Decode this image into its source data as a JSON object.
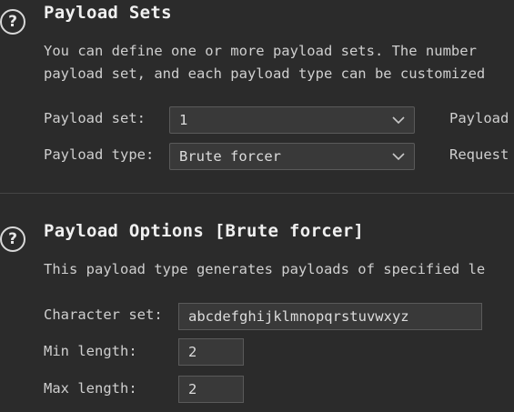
{
  "payload_sets": {
    "help_icon": "?",
    "title": "Payload Sets",
    "description_line1": "You can define one or more payload sets. The number",
    "description_line2": "payload set, and each payload type can be customized",
    "payload_set_label": "Payload set:",
    "payload_set_value": "1",
    "payload_type_label": "Payload type:",
    "payload_type_value": "Brute forcer",
    "right_label_1": "Payload",
    "right_label_2": "Request"
  },
  "payload_options": {
    "help_icon": "?",
    "title": "Payload Options [Brute forcer]",
    "description": "This payload type generates payloads of specified le",
    "character_set_label": "Character set:",
    "character_set_value": "abcdefghijklmnopqrstuvwxyz",
    "min_length_label": "Min length:",
    "min_length_value": "2",
    "max_length_label": "Max length:",
    "max_length_value": "2"
  },
  "icons": {
    "help": "help-icon",
    "dropdown": "chevron-down-icon"
  },
  "colors": {
    "background": "#2b2b2b",
    "input_background": "#393939",
    "border": "#5a5a5a",
    "text": "#cfcfcf",
    "title": "#f0f0f0"
  }
}
